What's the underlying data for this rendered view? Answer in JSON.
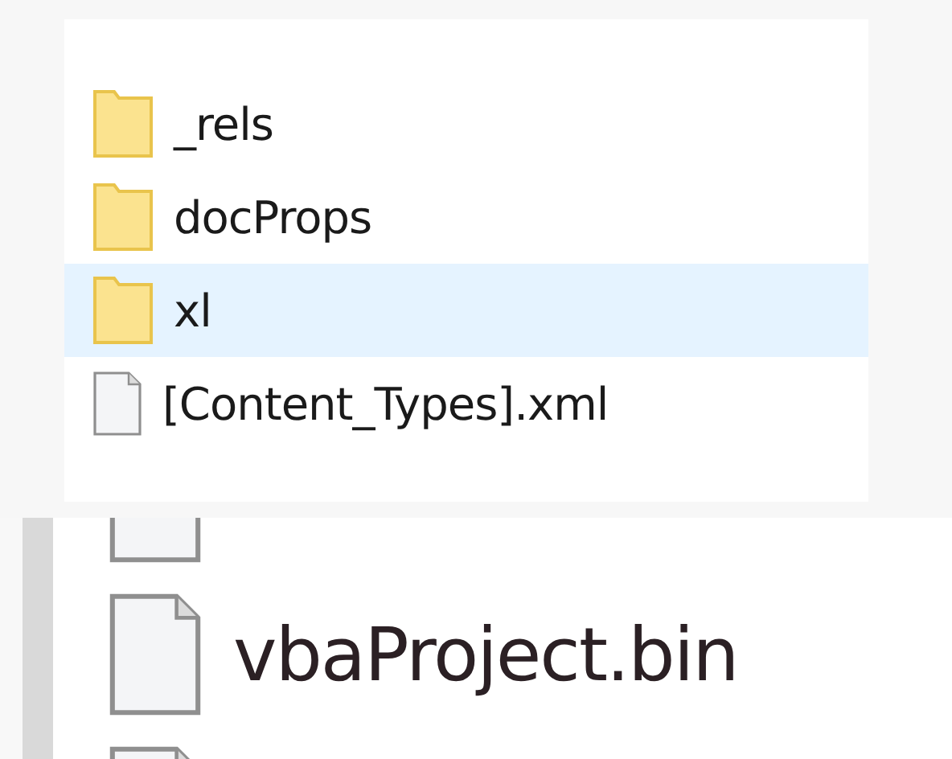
{
  "popup": {
    "items": [
      {
        "kind": "folder",
        "name": "_rels",
        "selected": false
      },
      {
        "kind": "folder",
        "name": "docProps",
        "selected": false
      },
      {
        "kind": "folder",
        "name": "xl",
        "selected": true
      },
      {
        "kind": "file",
        "name": "[Content_Types].xml",
        "selected": false
      }
    ]
  },
  "file_list": {
    "items": [
      {
        "kind": "file"
      },
      {
        "kind": "file",
        "name": "vbaProject.bin"
      },
      {
        "kind": "file"
      }
    ]
  }
}
